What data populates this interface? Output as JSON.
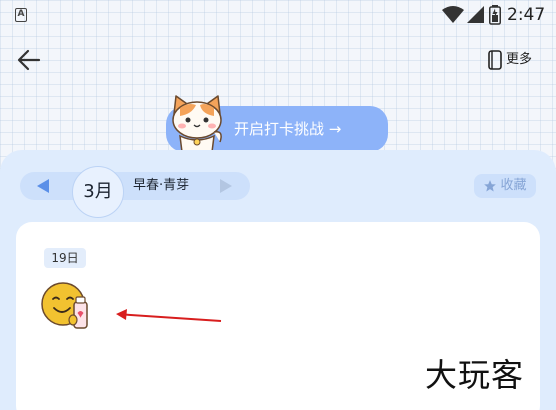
{
  "status_bar": {
    "app_icon_letter": "A",
    "time": "2:47"
  },
  "header": {
    "back_icon": "arrow-left-icon",
    "more_label": "更多"
  },
  "checkin": {
    "label": "开启打卡挑战 →",
    "mascot": "cat-mascot"
  },
  "calendar": {
    "month": "3月",
    "season": "早春·青芽",
    "favorite_label": "收藏"
  },
  "entry": {
    "day": "19日",
    "sticker": "smiley-with-drink-sticker"
  },
  "watermark": "大玩客",
  "colors": {
    "accent": "#8db3f9",
    "panel": "#dfecfd",
    "annotation": "#d81e1e"
  }
}
